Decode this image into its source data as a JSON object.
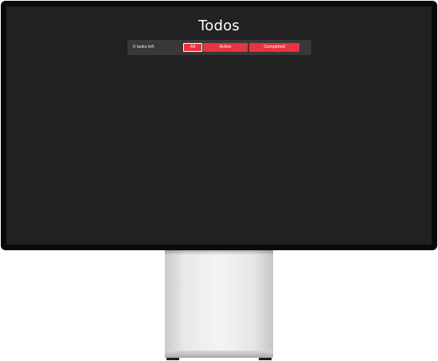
{
  "app": {
    "title": "Todos"
  },
  "toolbar": {
    "tasks_left": "0 tasks left",
    "filters": [
      {
        "label": "All",
        "selected": true
      },
      {
        "label": "Active",
        "selected": false
      },
      {
        "label": "Completed",
        "selected": false
      }
    ]
  },
  "colors": {
    "screen_background": "#212121",
    "toolbar_background": "#383838",
    "accent": "#e8343f",
    "text": "#ffffff"
  }
}
